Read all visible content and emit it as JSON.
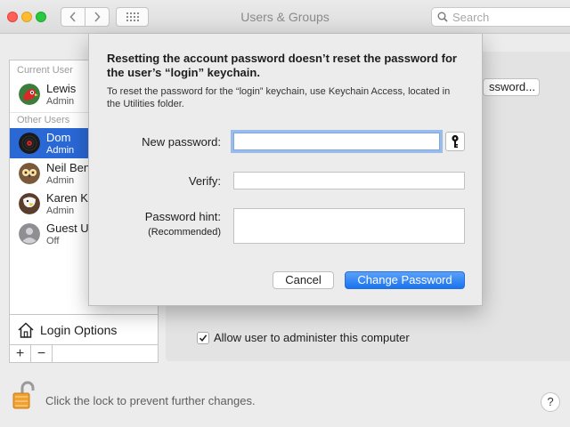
{
  "window": {
    "title": "Users & Groups",
    "search_placeholder": "Search"
  },
  "sidebar": {
    "current_header": "Current User",
    "other_header": "Other Users",
    "users": [
      {
        "name": "Lewis",
        "role": "Admin",
        "selected": false,
        "avatar": "parrot-avatar"
      },
      {
        "name": "Dom",
        "role": "Admin",
        "selected": true,
        "avatar": "vinyl-record-avatar"
      },
      {
        "name": "Neil Ben",
        "role": "Admin",
        "selected": false,
        "avatar": "owl-avatar"
      },
      {
        "name": "Karen Kl",
        "role": "Admin",
        "selected": false,
        "avatar": "eagle-avatar"
      },
      {
        "name": "Guest U",
        "role": "Off",
        "selected": false,
        "avatar": "guest-avatar"
      }
    ],
    "login_options": "Login Options",
    "add_label": "+",
    "remove_label": "−"
  },
  "panel": {
    "password_button_partial": "ssword...",
    "admin_checkbox_label": "Allow user to administer this computer",
    "admin_checked": true
  },
  "footer": {
    "lock_text": "Click the lock to prevent further changes.",
    "help_label": "?"
  },
  "sheet": {
    "title": "Resetting the account password doesn’t reset the password for the user’s “login” keychain.",
    "description": "To reset the password for the “login” keychain, use Keychain Access, located in the Utilities folder.",
    "new_password_label": "New password:",
    "new_password_value": "",
    "verify_label": "Verify:",
    "verify_value": "",
    "hint_label": "Password hint:",
    "hint_sublabel": "(Recommended)",
    "hint_value": "",
    "cancel_label": "Cancel",
    "change_label": "Change Password"
  },
  "colors": {
    "selection": "#2a68d6",
    "primary_button": "#1a73ef",
    "focus_ring": "#7aa7e8"
  }
}
